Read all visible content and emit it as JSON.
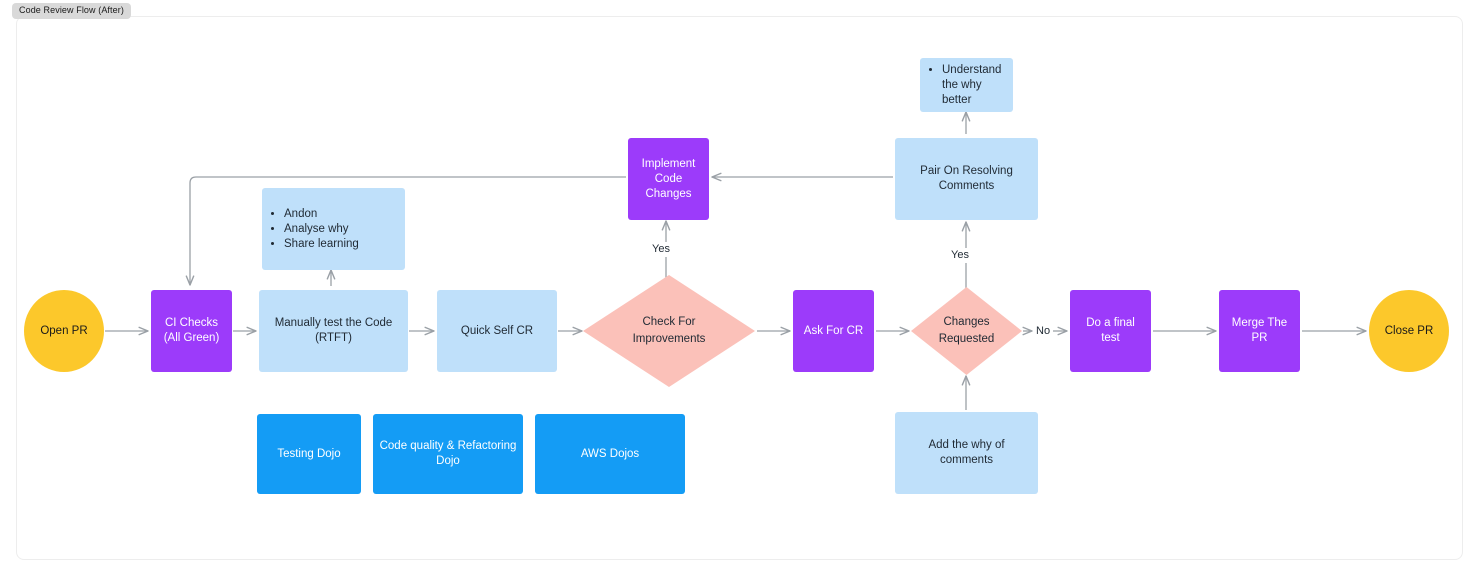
{
  "document": {
    "title_tab": "Code Review Flow (After)",
    "background": "#ffffff",
    "card_border": "#ededed"
  },
  "palette": {
    "yellow": "#fcc82b",
    "purple": "#9c3bfa",
    "light_blue": "#bfe0fa",
    "blue": "#149cf5",
    "pink": "#fbc1b9",
    "edge": "#9aa0a6",
    "text_dark": "#1f2933",
    "text_light": "#ffffff"
  },
  "chart_data": {
    "type": "diagram",
    "title": "Code Review Flow (After)",
    "nodes": [
      {
        "id": "open_pr",
        "label": "Open PR",
        "shape": "circle",
        "color": "#fcc82b"
      },
      {
        "id": "ci_checks",
        "label": "CI Checks\n(All Green)",
        "shape": "rect",
        "color": "#9c3bfa"
      },
      {
        "id": "manual_test",
        "label": "Manually test the Code\n(RTFT)",
        "shape": "rect",
        "color": "#bfe0fa"
      },
      {
        "id": "quick_self_cr",
        "label": "Quick Self CR",
        "shape": "rect",
        "color": "#bfe0fa"
      },
      {
        "id": "check_improve",
        "label": "Check For\nImprovements",
        "shape": "diamond",
        "color": "#fbc1b9"
      },
      {
        "id": "ask_for_cr",
        "label": "Ask For CR",
        "shape": "rect",
        "color": "#9c3bfa"
      },
      {
        "id": "changes_req",
        "label": "Changes\nRequested",
        "shape": "diamond",
        "color": "#fbc1b9"
      },
      {
        "id": "final_test",
        "label": "Do a final test",
        "shape": "rect",
        "color": "#9c3bfa"
      },
      {
        "id": "merge_pr",
        "label": "Merge The PR",
        "shape": "rect",
        "color": "#9c3bfa"
      },
      {
        "id": "close_pr",
        "label": "Close PR",
        "shape": "circle",
        "color": "#fcc82b"
      },
      {
        "id": "implement",
        "label": "Implement\nCode Changes",
        "shape": "rect",
        "color": "#9c3bfa"
      },
      {
        "id": "pair_resolve",
        "label": "Pair On Resolving\nComments",
        "shape": "rect",
        "color": "#bfe0fa"
      },
      {
        "id": "understand_why",
        "label": "Understand the why better",
        "shape": "rect",
        "color": "#bfe0fa",
        "bullets": [
          "Understand the why better"
        ]
      },
      {
        "id": "andon_notes",
        "shape": "rect",
        "color": "#bfe0fa",
        "bullets": [
          "Andon",
          "Analyse why",
          "Share learning"
        ]
      },
      {
        "id": "testing_dojo",
        "label": "Testing Dojo",
        "shape": "rect",
        "color": "#149cf5"
      },
      {
        "id": "quality_dojo",
        "label": "Code quality & Refactoring Dojo",
        "shape": "rect",
        "color": "#149cf5"
      },
      {
        "id": "aws_dojos",
        "label": "AWS Dojos",
        "shape": "rect",
        "color": "#149cf5"
      },
      {
        "id": "add_why",
        "label": "Add the why of comments",
        "shape": "rect",
        "color": "#bfe0fa"
      }
    ],
    "edges": [
      {
        "from": "open_pr",
        "to": "ci_checks",
        "label": ""
      },
      {
        "from": "ci_checks",
        "to": "manual_test",
        "label": ""
      },
      {
        "from": "manual_test",
        "to": "quick_self_cr",
        "label": ""
      },
      {
        "from": "quick_self_cr",
        "to": "check_improve",
        "label": ""
      },
      {
        "from": "check_improve",
        "to": "ask_for_cr",
        "label": ""
      },
      {
        "from": "check_improve",
        "to": "implement",
        "label": "Yes"
      },
      {
        "from": "ask_for_cr",
        "to": "changes_req",
        "label": ""
      },
      {
        "from": "changes_req",
        "to": "final_test",
        "label": "No"
      },
      {
        "from": "changes_req",
        "to": "pair_resolve",
        "label": "Yes"
      },
      {
        "from": "final_test",
        "to": "merge_pr",
        "label": ""
      },
      {
        "from": "merge_pr",
        "to": "close_pr",
        "label": ""
      },
      {
        "from": "pair_resolve",
        "to": "implement",
        "label": ""
      },
      {
        "from": "pair_resolve",
        "to": "understand_why",
        "label": ""
      },
      {
        "from": "implement",
        "to": "ci_checks",
        "label": ""
      },
      {
        "from": "manual_test",
        "to": "andon_notes",
        "label": ""
      },
      {
        "from": "add_why",
        "to": "changes_req",
        "label": ""
      }
    ]
  },
  "nodes": {
    "open_pr": {
      "label": "Open PR"
    },
    "ci_checks": {
      "line1": "CI Checks",
      "line2": "(All Green)"
    },
    "manual_test": {
      "line1": "Manually test the Code",
      "line2": "(RTFT)"
    },
    "quick_self_cr": {
      "label": "Quick Self CR"
    },
    "check_improve": {
      "line1": "Check For",
      "line2": "Improvements"
    },
    "ask_for_cr": {
      "label": "Ask For CR"
    },
    "changes_req": {
      "line1": "Changes",
      "line2": "Requested"
    },
    "final_test": {
      "label": "Do a final test"
    },
    "merge_pr": {
      "label": "Merge The PR"
    },
    "close_pr": {
      "label": "Close PR"
    },
    "implement": {
      "line1": "Implement",
      "line2": "Code Changes"
    },
    "pair_resolve": {
      "line1": "Pair On Resolving",
      "line2": "Comments"
    },
    "understand_why": {
      "bullet1": "Understand the why better"
    },
    "andon_notes": {
      "bullet1": "Andon",
      "bullet2": "Analyse why",
      "bullet3": "Share learning"
    },
    "testing_dojo": {
      "label": "Testing Dojo"
    },
    "quality_dojo": {
      "line1": "Code quality & Refactoring",
      "line2": "Dojo"
    },
    "aws_dojos": {
      "label": "AWS Dojos"
    },
    "add_why": {
      "label": "Add the why of comments"
    }
  },
  "edge_labels": {
    "yes_improvements": "Yes",
    "yes_changes": "Yes",
    "no_changes": "No"
  }
}
